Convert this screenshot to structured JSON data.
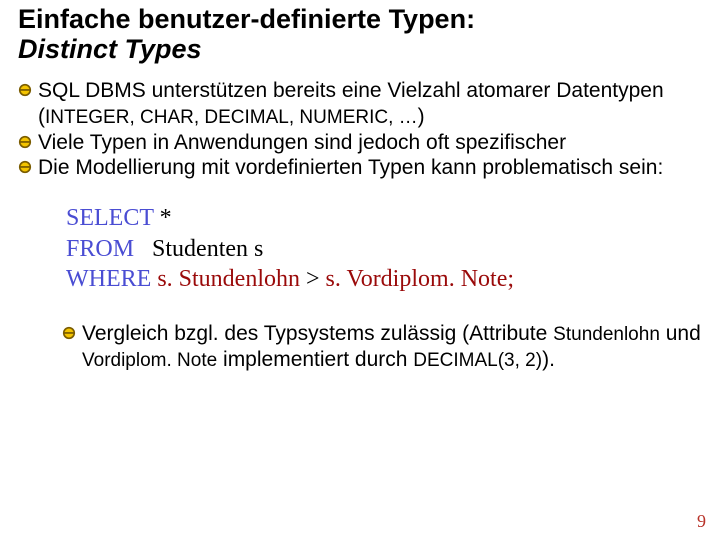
{
  "title": {
    "line1": "Einfache benutzer-definierte Typen:",
    "line2": "Distinct Types"
  },
  "bullets": [
    {
      "pre": "SQL DBMS unterstützen bereits eine Vielzahl atomarer Datentypen (",
      "types": "INTEGER, CHAR, DECIMAL, NUMERIC, …",
      "post": ")"
    },
    {
      "text": "Viele Typen in Anwendungen sind jedoch oft spezifischer"
    },
    {
      "text": "Die Modellierung mit vordefinierten Typen kann problematisch sein:"
    }
  ],
  "sql": {
    "select_kw": "SELECT",
    "select_rest": " *",
    "from_kw": "FROM",
    "from_rest": "   Studenten s",
    "where_kw": "WHERE",
    "where_lhs": " s. Stundenlohn",
    "where_op": " > ",
    "where_rhs": "s. Vordiplom. Note;"
  },
  "sub": {
    "part1": "Vergleich bzgl. des Typsystems zulässig (Attribute ",
    "attr1": "Stundenlohn",
    "mid": " und ",
    "attr2": "Vordiplom. Note",
    "part2": " implementiert durch ",
    "decimal": "DECIMAL(3, 2)",
    "tail": ")."
  },
  "page": "9"
}
